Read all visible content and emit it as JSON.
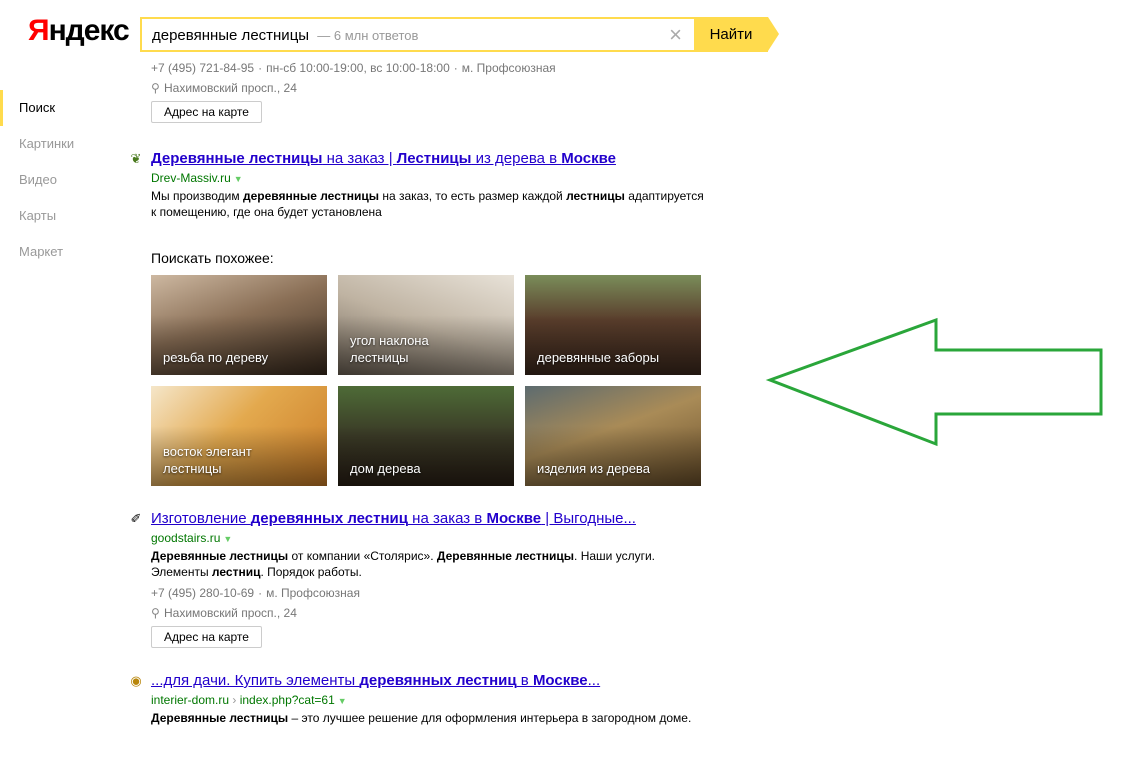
{
  "logo": {
    "first": "Я",
    "rest": "ндекс"
  },
  "search": {
    "query": "деревянные лестницы",
    "count": "— 6 млн ответов",
    "button": "Найти"
  },
  "sidebar": {
    "items": [
      {
        "label": "Поиск"
      },
      {
        "label": "Картинки"
      },
      {
        "label": "Видео"
      },
      {
        "label": "Карты"
      },
      {
        "label": "Маркет"
      }
    ]
  },
  "result0": {
    "phone": "+7 (495) 721-84-95",
    "hours": "пн-сб 10:00-19:00, вс 10:00-18:00",
    "metro": "м. Профсоюзная",
    "address": "Нахимовский просп., 24",
    "map_button": "Адрес на карте"
  },
  "result1": {
    "title_parts": [
      "Деревянные лестницы",
      " на заказ | ",
      "Лестницы",
      " из дерева в ",
      "Москве"
    ],
    "url": "Drev-Massiv.ru",
    "snippet_parts": [
      "Мы производим ",
      "деревянные лестницы",
      " на заказ, то есть размер каждой ",
      "лестницы",
      " адаптируется к помещению, где она будет установлена"
    ]
  },
  "similar": {
    "title": "Поискать похожее:",
    "tiles": [
      {
        "caption": "резьба по дереву"
      },
      {
        "caption": "угол наклона лестницы"
      },
      {
        "caption": "деревянные заборы"
      },
      {
        "caption": "восток элегант лестницы"
      },
      {
        "caption": "дом дерева"
      },
      {
        "caption": "изделия из дерева"
      }
    ]
  },
  "result2": {
    "title_parts": [
      "Изготовление ",
      "деревянных лестниц",
      " на заказ в ",
      "Москве",
      " | Выгодные..."
    ],
    "url": "goodstairs.ru",
    "snippet_parts": [
      "Деревянные лестницы",
      " от компании «Столярис». ",
      "Деревянные лестницы",
      ". Наши услуги. Элементы ",
      "лестниц",
      ". Порядок работы."
    ],
    "phone": "+7 (495) 280-10-69",
    "metro": "м. Профсоюзная",
    "address": "Нахимовский просп., 24",
    "map_button": "Адрес на карте"
  },
  "result3": {
    "title_parts": [
      "...для дачи. Купить элементы ",
      "деревянных лестниц",
      " в ",
      "Москве",
      "..."
    ],
    "url": "interier-dom.ru",
    "url_path": "index.php?cat=61",
    "snippet_parts": [
      "Деревянные лестницы",
      " – это лучшее решение для оформления интерьера в загородном доме."
    ]
  },
  "colors": {
    "accent": "#ffdb4d",
    "link": "#2200cc",
    "url": "#007700",
    "arrow": "#2aa63a"
  },
  "icons": {
    "search_clear": "close-icon",
    "address": "map-pin-icon"
  }
}
